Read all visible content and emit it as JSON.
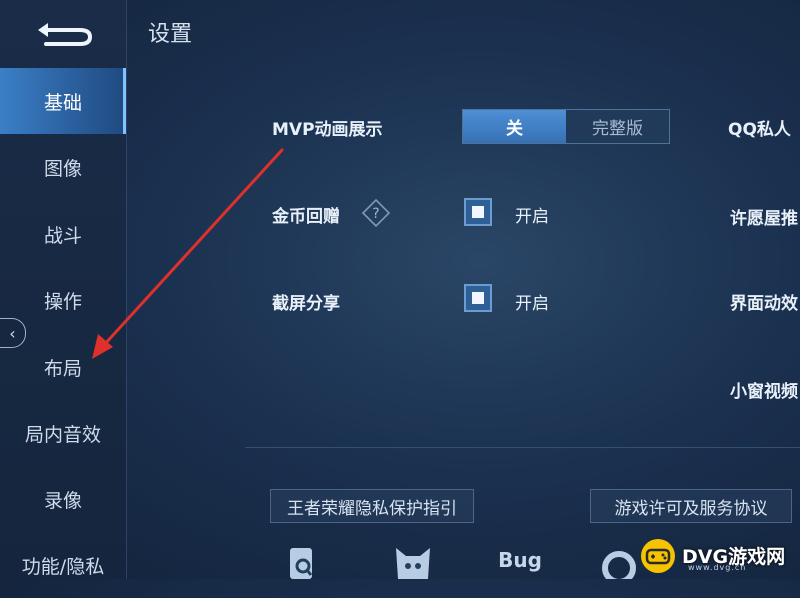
{
  "header": {
    "title": "设置"
  },
  "sidebar": {
    "items": [
      {
        "label": "基础",
        "active": true
      },
      {
        "label": "图像"
      },
      {
        "label": "战斗"
      },
      {
        "label": "操作"
      },
      {
        "label": "布局"
      },
      {
        "label": "局内音效"
      },
      {
        "label": "录像"
      },
      {
        "label": "功能/隐私"
      }
    ]
  },
  "settings": {
    "mvp": {
      "label": "MVP动画展示",
      "options": [
        "关",
        "完整版"
      ],
      "selected": "关"
    },
    "coin_gift": {
      "label": "金币回赠",
      "toggle_label": "开启",
      "checked": true
    },
    "screenshot_share": {
      "label": "截屏分享",
      "toggle_label": "开启",
      "checked": true
    },
    "right_column": [
      "QQ私人",
      "许愿屋推",
      "界面动效",
      "小窗视频"
    ]
  },
  "links": {
    "privacy": "王者荣耀隐私保护指引",
    "license": "游戏许可及服务协议"
  },
  "bottom_bar": {
    "bug_label": "Bug"
  },
  "watermark": {
    "text": "DVG游戏网",
    "sub": "www.dvg.cn"
  },
  "colors": {
    "accent": "#3b7fc6",
    "arrow": "#e0302c"
  }
}
